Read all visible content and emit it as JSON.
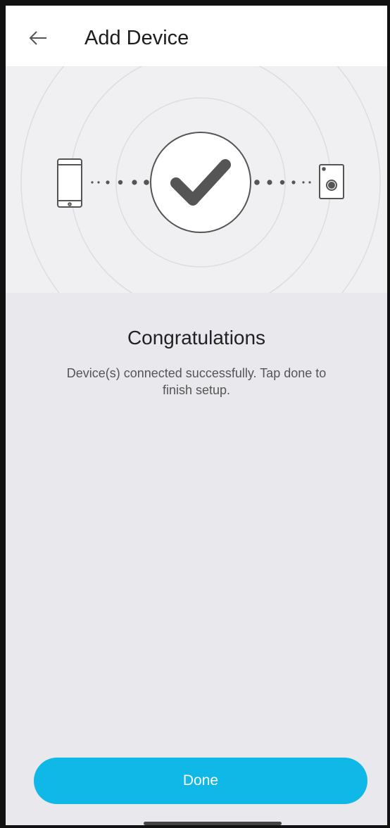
{
  "header": {
    "back_icon": "arrow-left-icon",
    "title": "Add Device"
  },
  "hero": {
    "phone_icon": "smartphone-icon",
    "status_icon": "checkmark-icon",
    "device_icon": "camera-device-icon"
  },
  "content": {
    "heading": "Congratulations",
    "message": "Device(s) connected successfully. Tap done to finish setup."
  },
  "footer": {
    "done_label": "Done"
  },
  "colors": {
    "accent": "#10b8e8",
    "background": "#e9e8ed",
    "hero_background": "#f0f0f3",
    "icon_stroke": "#555555"
  }
}
